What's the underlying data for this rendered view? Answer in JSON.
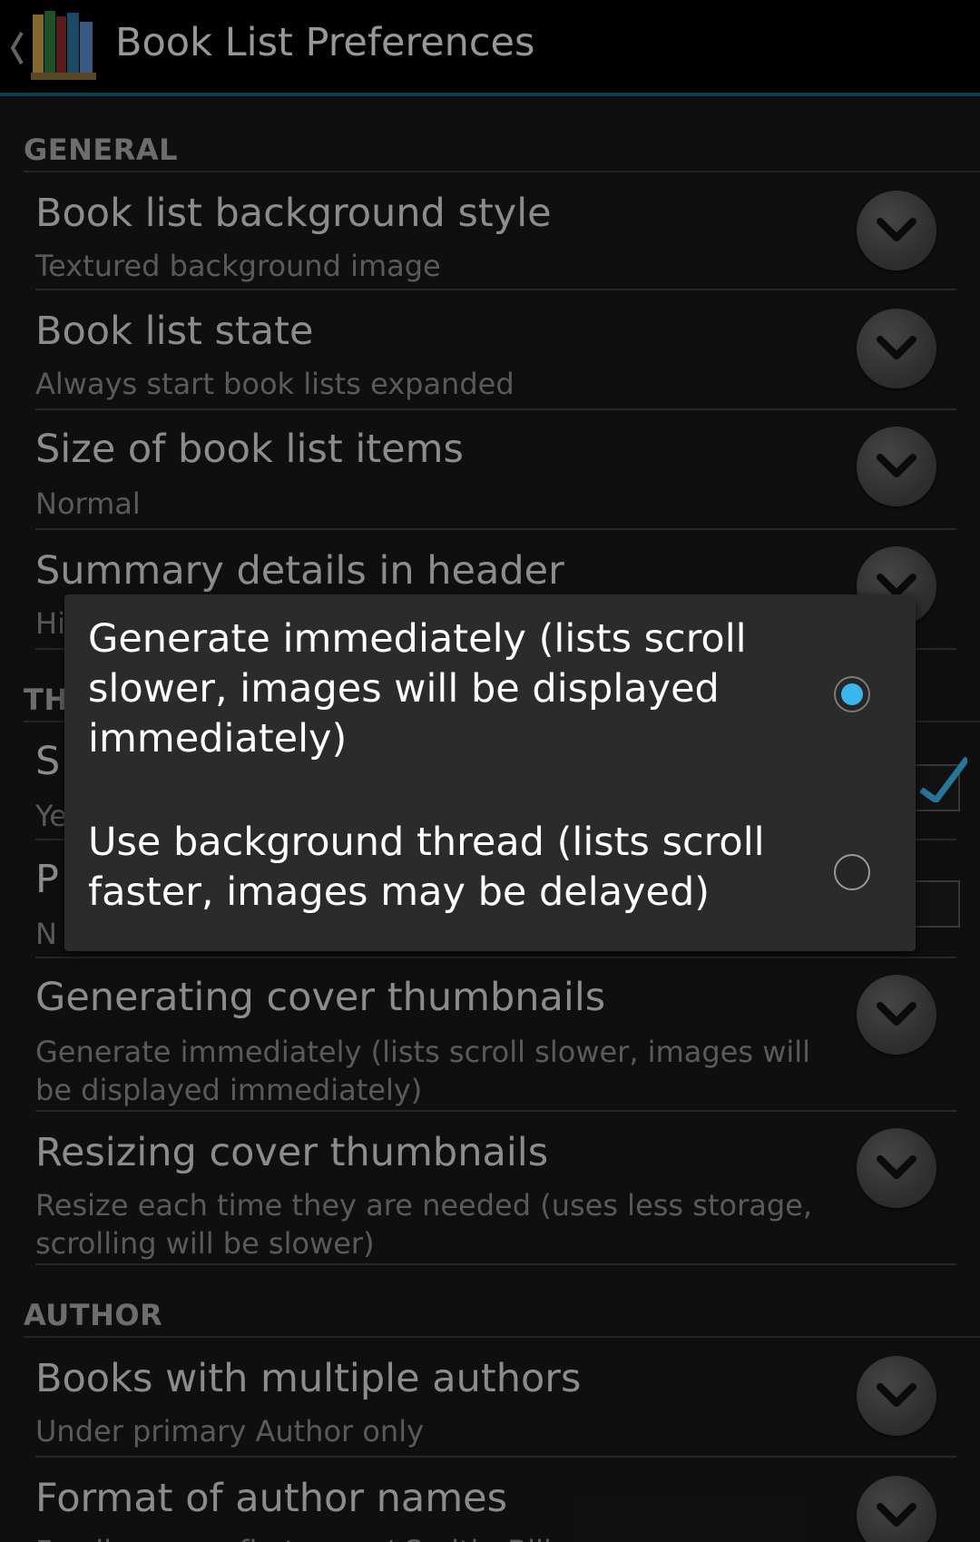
{
  "app": {
    "title": "Book List Preferences",
    "icon": "bookshelf-app-icon"
  },
  "categories": {
    "general": "GENERAL",
    "thumbnails_partial": "TH",
    "author": "AUTHOR"
  },
  "prefs": {
    "bg_style": {
      "title": "Book list background style",
      "summary": "Textured background image"
    },
    "list_state": {
      "title": "Book list state",
      "summary": "Always start book lists expanded"
    },
    "item_size": {
      "title": "Size of book list items",
      "summary": "Normal"
    },
    "summary_header": {
      "title": "Summary details in header",
      "summary_partial": "Hi"
    },
    "thumb_show": {
      "title_partial": "S",
      "summary_partial": "Ye"
    },
    "thumb_p": {
      "title_partial": "P",
      "summary_partial": "N"
    },
    "gen_thumbs": {
      "title": "Generating cover thumbnails",
      "summary": "Generate immediately (lists scroll slower, images will be displayed immediately)"
    },
    "resize_thumbs": {
      "title": "Resizing cover thumbnails",
      "summary": "Resize each time they are needed (uses less storage, scrolling will be slower)"
    },
    "multi_authors": {
      "title": "Books with multiple authors",
      "summary": "Under primary Author only"
    },
    "author_format": {
      "title": "Format of author names",
      "summary_partial": "Family name, first name' Smith, Bill"
    }
  },
  "dialog": {
    "options": [
      {
        "label": "Generate immediately (lists scroll slower, images will be displayed immediately)",
        "selected": true
      },
      {
        "label": "Use background thread (lists scroll faster, images may be delayed)",
        "selected": false
      }
    ]
  },
  "colors": {
    "accent": "#3ab6ec",
    "actionbar_underline": "#1e5c80",
    "background": "#181818",
    "dialog": "#2b2b2b"
  }
}
